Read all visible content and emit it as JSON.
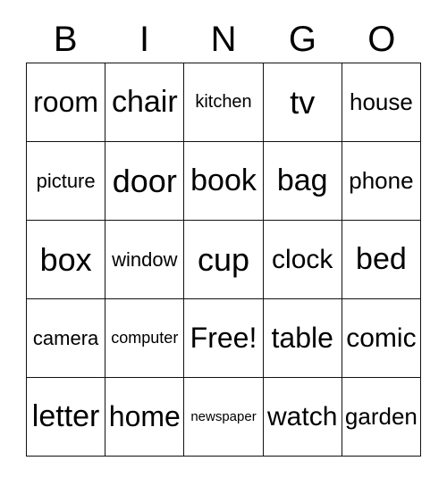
{
  "card": {
    "title": "BINGO",
    "header_letters": [
      "B",
      "I",
      "N",
      "G",
      "O"
    ],
    "free_space_label": "Free!",
    "free_space_position": {
      "row": 3,
      "column": 2
    },
    "grid_size": {
      "rows": 5,
      "columns": 5
    },
    "colors": {
      "background": "#ffffff",
      "text": "#000000",
      "border": "#111111"
    },
    "rows": [
      [
        {
          "text": "room",
          "size": 32
        },
        {
          "text": "chair",
          "size": 34
        },
        {
          "text": "kitchen",
          "size": 20
        },
        {
          "text": "tv",
          "size": 36
        },
        {
          "text": "house",
          "size": 26
        }
      ],
      [
        {
          "text": "picture",
          "size": 22
        },
        {
          "text": "door",
          "size": 36
        },
        {
          "text": "book",
          "size": 34
        },
        {
          "text": "bag",
          "size": 34
        },
        {
          "text": "phone",
          "size": 26
        }
      ],
      [
        {
          "text": "box",
          "size": 36
        },
        {
          "text": "window",
          "size": 22
        },
        {
          "text": "cup",
          "size": 36
        },
        {
          "text": "clock",
          "size": 30
        },
        {
          "text": "bed",
          "size": 34
        }
      ],
      [
        {
          "text": "camera",
          "size": 22
        },
        {
          "text": "computer",
          "size": 18
        },
        {
          "text": "Free!",
          "size": 32
        },
        {
          "text": "table",
          "size": 32
        },
        {
          "text": "comic",
          "size": 30
        }
      ],
      [
        {
          "text": "letter",
          "size": 34
        },
        {
          "text": "home",
          "size": 32
        },
        {
          "text": "newspaper",
          "size": 15
        },
        {
          "text": "watch",
          "size": 30
        },
        {
          "text": "garden",
          "size": 26
        }
      ]
    ]
  }
}
